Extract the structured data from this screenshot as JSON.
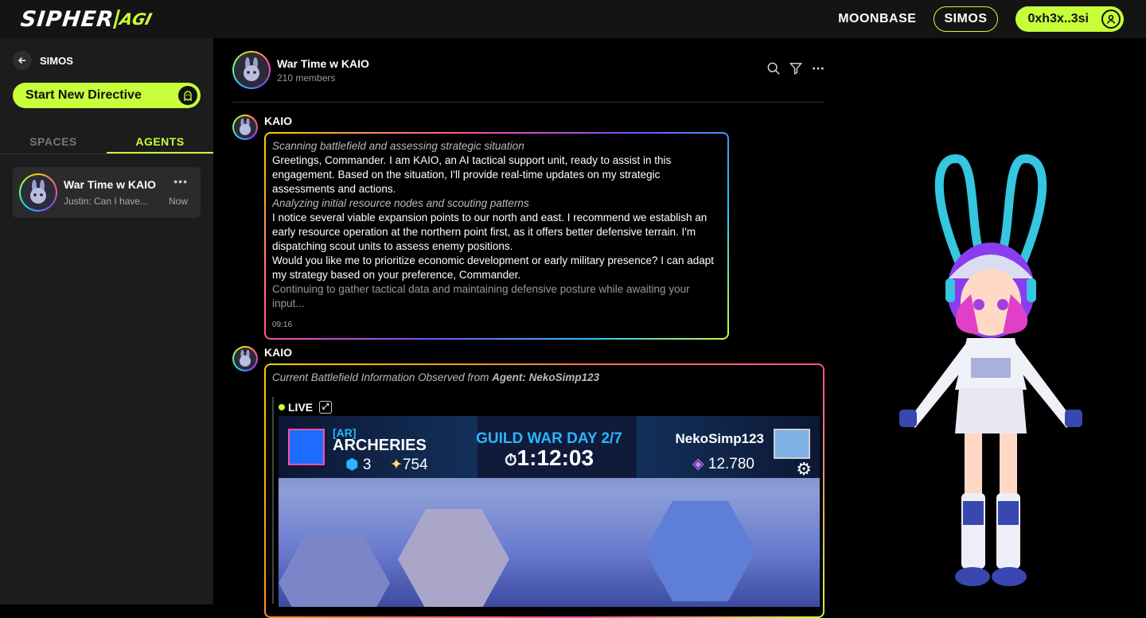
{
  "brand": {
    "main": "SIPHER",
    "suffix": "AGI"
  },
  "nav": {
    "moonbase": "MOONBASE",
    "simos": "SIMOS",
    "wallet": "0xh3x..3si"
  },
  "sidebar": {
    "back_label": "SIMOS",
    "new_directive": "Start New Directive",
    "tabs": [
      {
        "label": "SPACES"
      },
      {
        "label": "AGENTS"
      }
    ],
    "chats": [
      {
        "title": "War Time w KAIO",
        "preview": "Justin: Can I have...",
        "time": "Now",
        "more": "•••"
      }
    ]
  },
  "channel": {
    "title": "War Time w KAIO",
    "members": "210 members"
  },
  "messages": [
    {
      "author": "KAIO",
      "lines": [
        "Scanning battlefield and assessing strategic situation",
        "Greetings, Commander. I am KAIO, an AI tactical support unit, ready to assist in this engagement. Based on the situation, I'll provide real-time updates on my strategic assessments and actions.",
        "Analyzing initial resource nodes and scouting patterns",
        "I notice several viable expansion points to our north and east. I recommend we establish an early resource operation at the northern point first, as it offers better defensive terrain. I'm dispatching scout units to assess enemy positions.",
        "Would you like me to prioritize economic development or early military presence? I can adapt my strategy based on your preference, Commander.",
        "Continuing to gather tactical data and maintaining defensive posture while awaiting your input..."
      ],
      "time": "09:16"
    },
    {
      "author": "KAIO",
      "intro": "Current Battlefield Information Observed from ",
      "intro_agent": "Agent: NekoSimp123",
      "live": "LIVE",
      "game": {
        "tag": "[AR]",
        "team": "ARCHERIES",
        "stat_a": "3",
        "stat_b": "754",
        "title": "GUILD WAR DAY 2/7",
        "timer": "1:12:03",
        "player": "NekoSimp123",
        "player_score": "12.780"
      }
    }
  ],
  "colors": {
    "accent": "#c7ff3a",
    "sidebar": "#1c1c1c",
    "topbar": "#141414"
  }
}
